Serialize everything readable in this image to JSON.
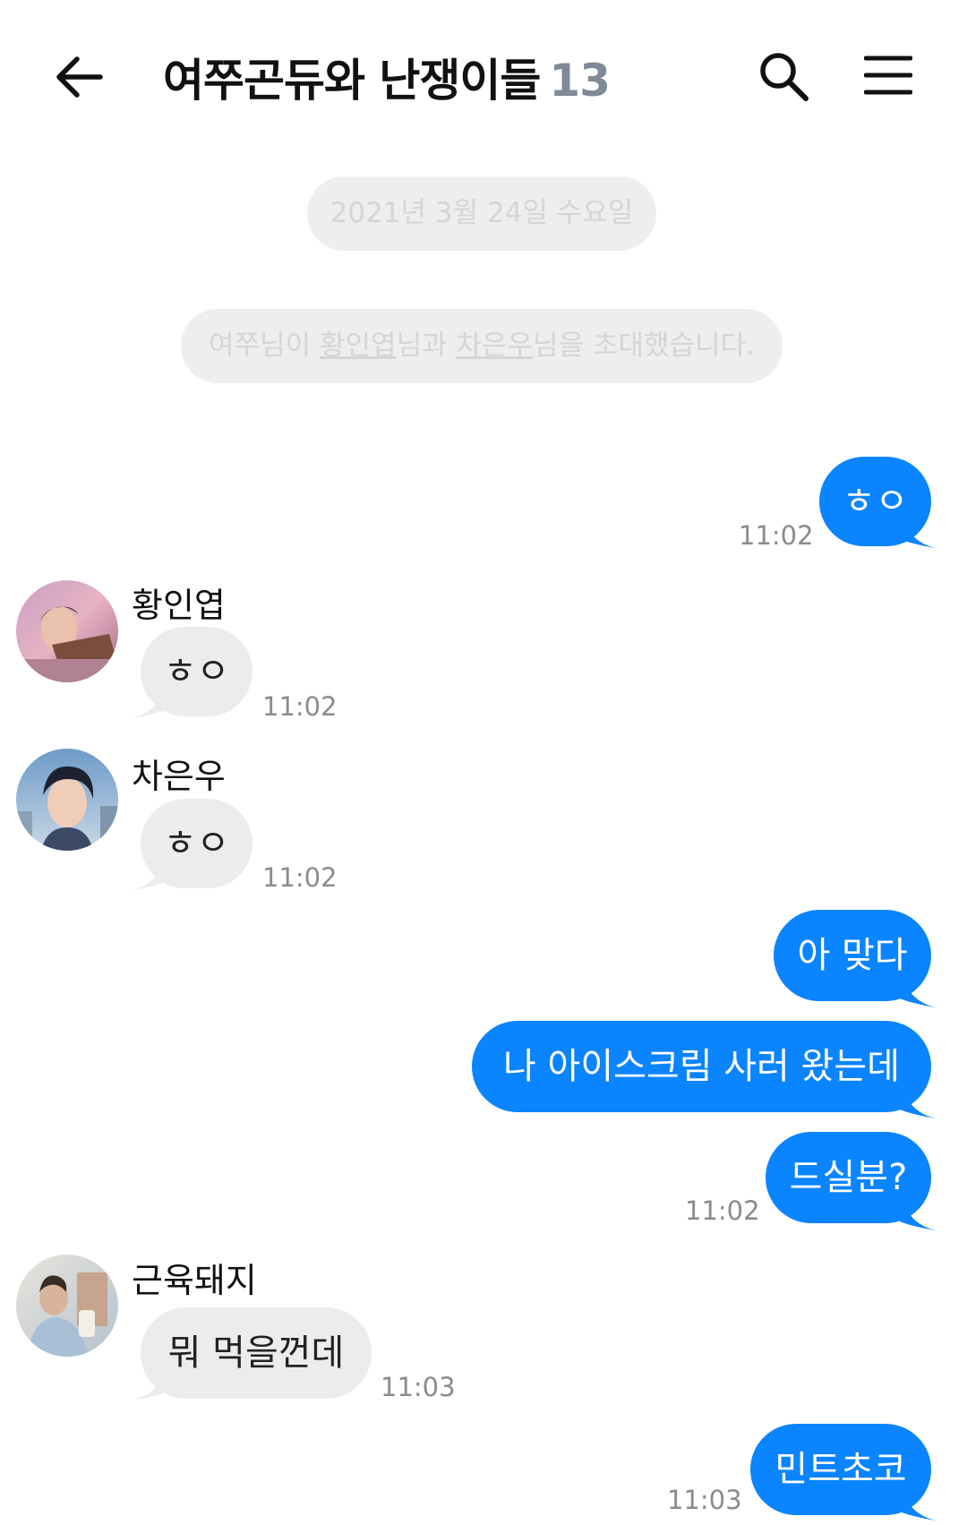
{
  "header": {
    "title": "여쭈곤듀와 난쟁이들",
    "member_count": "13"
  },
  "system": {
    "date": "2021년 3월 24일 수요일",
    "invite_prefix": "여쭈님이 ",
    "invite_user1": "황인엽",
    "invite_mid": "님과 ",
    "invite_user2": "차은우",
    "invite_suffix": "님을 초대했습니다."
  },
  "messages": [
    {
      "text": "ㅎㅇ",
      "time": "11:02"
    },
    {
      "name": "황인엽",
      "text": "ㅎㅇ",
      "time": "11:02"
    },
    {
      "name": "차은우",
      "text": "ㅎㅇ",
      "time": "11:02"
    },
    {
      "text": "아 맞다"
    },
    {
      "text": "나 아이스크림 사러 왔는데"
    },
    {
      "text": "드실분?",
      "time": "11:02"
    },
    {
      "name": "근육돼지",
      "text": "뭐 먹을껀데",
      "time": "11:03"
    },
    {
      "text": "민트초코",
      "time": "11:03"
    }
  ],
  "colors": {
    "accent": "#0a84ff",
    "received": "#ececee",
    "system_bg": "#eeeef0",
    "count": "#7f8a96"
  }
}
